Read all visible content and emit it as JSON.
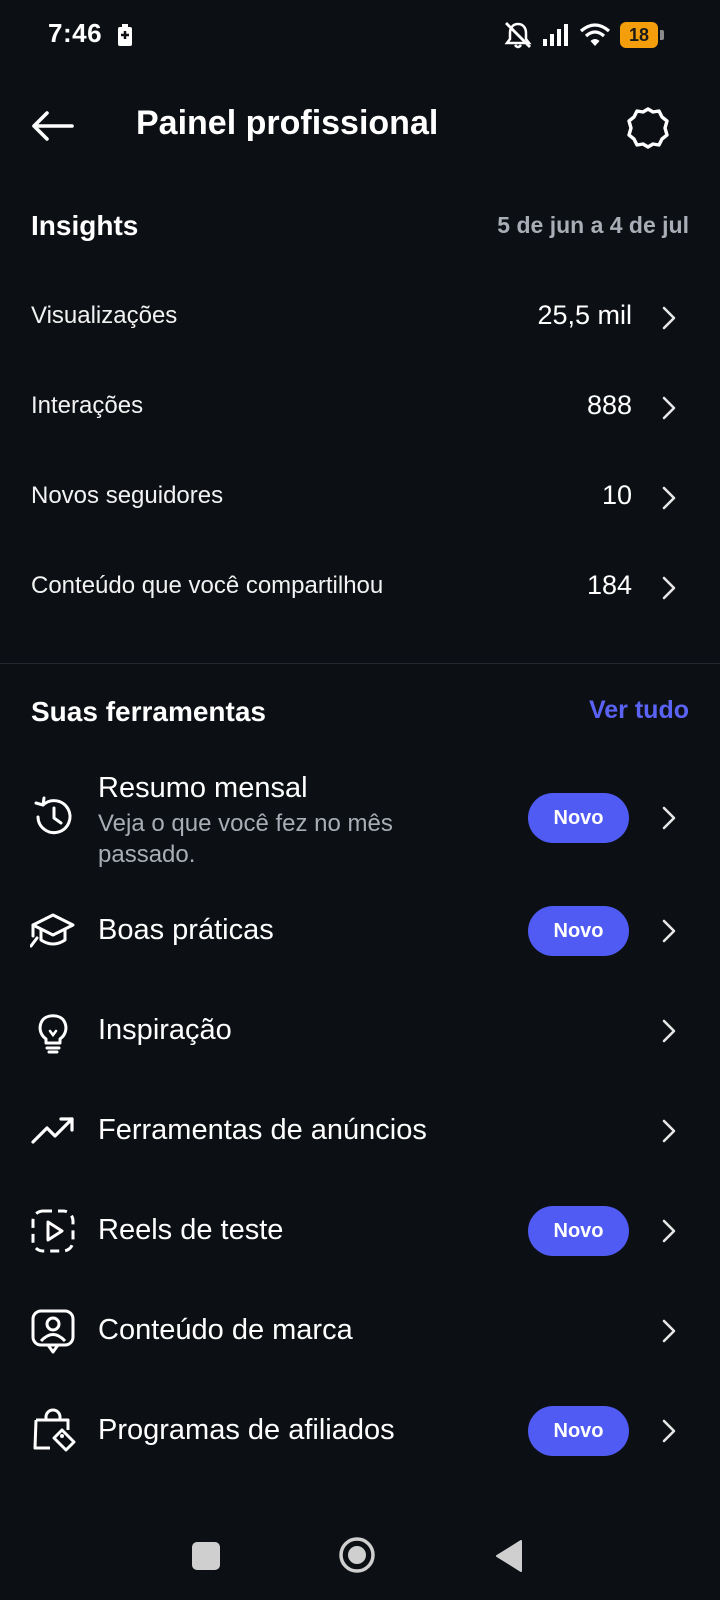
{
  "status_bar": {
    "time": "7:46",
    "battery_level": "18",
    "icons": [
      "battery-charging-icon",
      "mute-icon",
      "signal-icon",
      "wifi-icon",
      "battery-icon"
    ]
  },
  "header": {
    "title": "Painel profissional",
    "back_icon": "arrow-left-icon",
    "settings_icon": "gear-icon"
  },
  "insights": {
    "title": "Insights",
    "date_range": "5 de jun a 4 de jul",
    "metrics": [
      {
        "label": "Visualizações",
        "value": "25,5 mil"
      },
      {
        "label": "Interações",
        "value": "888"
      },
      {
        "label": "Novos seguidores",
        "value": "10"
      },
      {
        "label": "Conteúdo que você compartilhou",
        "value": "184"
      }
    ]
  },
  "tools": {
    "title": "Suas ferramentas",
    "see_all": "Ver tudo",
    "badge_label": "Novo",
    "items": [
      {
        "label": "Resumo mensal",
        "subtitle": "Veja o que você fez no mês passado.",
        "icon": "history-icon",
        "badge": "Novo"
      },
      {
        "label": "Boas práticas",
        "icon": "graduation-cap-icon",
        "badge": "Novo"
      },
      {
        "label": "Inspiração",
        "icon": "lightbulb-icon"
      },
      {
        "label": "Ferramentas de anúncios",
        "icon": "trending-up-icon"
      },
      {
        "label": "Reels de teste",
        "icon": "reels-test-icon",
        "badge": "Novo"
      },
      {
        "label": "Conteúdo de marca",
        "icon": "branded-content-icon"
      },
      {
        "label": "Programas de afiliados",
        "icon": "shopping-bag-tag-icon",
        "badge": "Novo"
      }
    ]
  },
  "colors": {
    "background": "#0c0f14",
    "accent": "#4f5bf3",
    "link": "#5b63f5",
    "muted_text": "#a8adb6",
    "battery": "#f59e0b"
  }
}
